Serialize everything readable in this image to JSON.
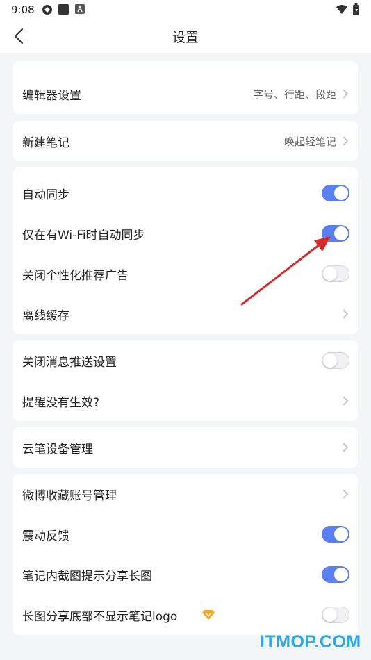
{
  "status_bar": {
    "time": "9:08"
  },
  "header": {
    "title": "设置"
  },
  "cards": {
    "editor": {
      "label": "编辑器设置",
      "value": "字号、行距、段距"
    },
    "new_note": {
      "label": "新建笔记",
      "value": "唤起轻笔记"
    },
    "sync": {
      "auto_sync": {
        "label": "自动同步",
        "enabled": true
      },
      "wifi_only": {
        "label": "仅在有Wi-Fi时自动同步",
        "enabled": true
      },
      "ads": {
        "label": "关闭个性化推荐广告",
        "enabled": false
      },
      "offline_cache": {
        "label": "离线缓存"
      }
    },
    "notify": {
      "close_push": {
        "label": "关闭消息推送设置",
        "enabled": false
      },
      "reminder": {
        "label": "提醒没有生效?"
      }
    },
    "device": {
      "label": "云笔设备管理"
    },
    "misc": {
      "weibo": {
        "label": "微博收藏账号管理"
      },
      "vibration": {
        "label": "震动反馈",
        "enabled": true
      },
      "screenshot_share": {
        "label": "笔记内截图提示分享长图",
        "enabled": true
      },
      "hide_logo": {
        "label": "长图分享底部不显示笔记logo",
        "enabled": false
      }
    }
  },
  "watermark": "ITMOP.COM",
  "colors": {
    "accent": "#5a7ff0",
    "arrow": "#e53030",
    "watermark": "#2aa8e0",
    "vip_badge": "#f5a623"
  },
  "icons": [
    "back-icon",
    "chevron-right-icon",
    "vip-diamond-icon",
    "wifi-icon",
    "battery-icon",
    "signal-icon"
  ]
}
